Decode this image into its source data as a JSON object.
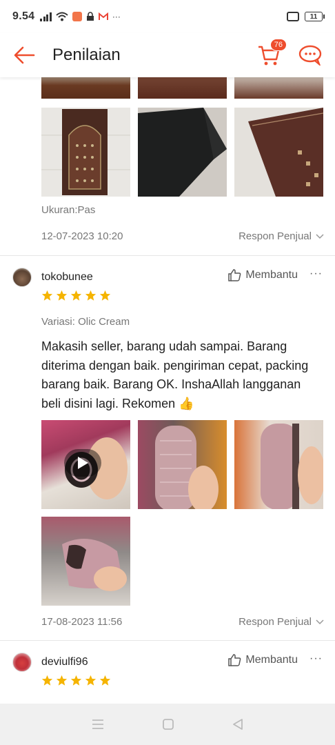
{
  "status_bar": {
    "time": "9.54",
    "battery": "11",
    "colors": {
      "app1": "#f2754a",
      "gmail": "#ea4335"
    }
  },
  "header": {
    "title": "Penilaian",
    "cart_count": "76",
    "accent": "#ee4d2d"
  },
  "reviews": [
    {
      "detail": "Ukuran:Pas",
      "date": "12-07-2023 10:20",
      "respon_label": "Respon Penjual"
    },
    {
      "username": "tokobunee",
      "helpful_label": "Membantu",
      "more": "···",
      "rating": 5,
      "variasi": "Variasi: Olic Cream",
      "comment": "Makasih seller, barang udah sampai. Barang diterima dengan baik. pengiriman cepat, packing barang baik. Barang OK. InshaAllah langganan beli disini lagi. Rekomen 👍",
      "date": "17-08-2023 11:56",
      "respon_label": "Respon Penjual"
    },
    {
      "username": "deviulfi96",
      "helpful_label": "Membantu",
      "more": "···",
      "rating": 5
    }
  ],
  "star_color": "#f5b400"
}
